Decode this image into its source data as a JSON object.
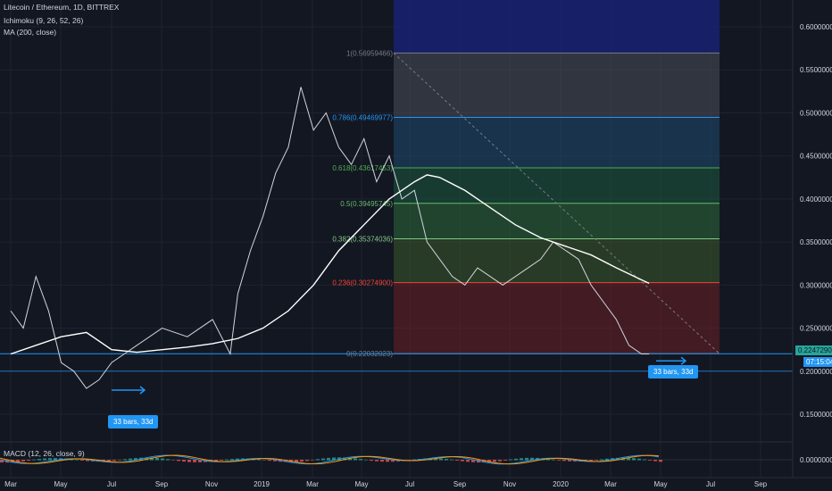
{
  "header": {
    "symbol_line": "Litecoin / Ethereum, 1D, BITTREX",
    "indicator_1": "Ichimoku (9, 26, 52, 26)",
    "indicator_2": "MA (200, close)",
    "macd_label": "MACD (12, 26, close, 9)"
  },
  "chart_data": {
    "type": "line",
    "title": "Litecoin / Ethereum, 1D, BITTREX",
    "x_tick_labels": [
      "Mar",
      "May",
      "Jul",
      "Sep",
      "Nov",
      "2019",
      "Mar",
      "May",
      "Jul",
      "Sep",
      "Nov",
      "2020",
      "Mar",
      "May",
      "Jul",
      "Sep"
    ],
    "y_tick_labels": [
      "0.60000000",
      "0.55000000",
      "0.50000000",
      "0.45000000",
      "0.40000000",
      "0.35000000",
      "0.30000000",
      "0.25000000",
      "0.20000000",
      "0.15000000"
    ],
    "ylim": [
      0.1,
      0.63
    ],
    "macd_tick_label": "0.00000000",
    "series": [
      {
        "name": "LTC/ETH close",
        "color": "#d1d4dc",
        "points": [
          [
            0,
            0.27
          ],
          [
            0.5,
            0.25
          ],
          [
            1,
            0.31
          ],
          [
            1.5,
            0.27
          ],
          [
            2,
            0.21
          ],
          [
            2.5,
            0.2
          ],
          [
            3,
            0.18
          ],
          [
            3.5,
            0.19
          ],
          [
            4,
            0.21
          ],
          [
            5,
            0.23
          ],
          [
            6,
            0.25
          ],
          [
            7,
            0.24
          ],
          [
            8,
            0.26
          ],
          [
            8.7,
            0.22
          ],
          [
            9,
            0.29
          ],
          [
            9.5,
            0.34
          ],
          [
            10,
            0.38
          ],
          [
            10.5,
            0.43
          ],
          [
            11,
            0.46
          ],
          [
            11.5,
            0.53
          ],
          [
            12,
            0.48
          ],
          [
            12.5,
            0.5
          ],
          [
            13,
            0.46
          ],
          [
            13.5,
            0.44
          ],
          [
            14,
            0.47
          ],
          [
            14.5,
            0.42
          ],
          [
            15,
            0.45
          ],
          [
            15.5,
            0.4
          ],
          [
            16,
            0.41
          ],
          [
            16.5,
            0.35
          ],
          [
            17,
            0.33
          ],
          [
            17.5,
            0.31
          ],
          [
            18,
            0.3
          ],
          [
            18.5,
            0.32
          ],
          [
            19,
            0.31
          ],
          [
            19.5,
            0.3
          ],
          [
            20,
            0.31
          ],
          [
            20.5,
            0.32
          ],
          [
            21,
            0.33
          ],
          [
            21.5,
            0.35
          ],
          [
            22,
            0.34
          ],
          [
            22.5,
            0.33
          ],
          [
            23,
            0.3
          ],
          [
            23.5,
            0.28
          ],
          [
            24,
            0.26
          ],
          [
            24.5,
            0.23
          ],
          [
            25,
            0.22
          ],
          [
            25.3,
            0.22
          ]
        ]
      },
      {
        "name": "MA (200, close)",
        "color": "#ffffff",
        "points": [
          [
            0,
            0.22
          ],
          [
            1,
            0.23
          ],
          [
            2,
            0.24
          ],
          [
            3,
            0.245
          ],
          [
            4,
            0.225
          ],
          [
            5,
            0.222
          ],
          [
            6,
            0.225
          ],
          [
            7,
            0.228
          ],
          [
            8,
            0.232
          ],
          [
            9,
            0.238
          ],
          [
            10,
            0.25
          ],
          [
            11,
            0.27
          ],
          [
            12,
            0.3
          ],
          [
            13,
            0.34
          ],
          [
            14,
            0.37
          ],
          [
            15,
            0.4
          ],
          [
            16,
            0.42
          ],
          [
            16.5,
            0.428
          ],
          [
            17,
            0.425
          ],
          [
            18,
            0.41
          ],
          [
            19,
            0.39
          ],
          [
            20,
            0.37
          ],
          [
            21,
            0.355
          ],
          [
            22,
            0.345
          ],
          [
            23,
            0.335
          ],
          [
            24,
            0.32
          ],
          [
            25,
            0.306
          ],
          [
            25.3,
            0.302
          ]
        ]
      }
    ],
    "fibonacci": {
      "levels": [
        {
          "ratio": "1",
          "price": "0.56959466",
          "color": "#787b86"
        },
        {
          "ratio": "0.786",
          "price": "0.49469977",
          "color": "#2196f3"
        },
        {
          "ratio": "0.618",
          "price": "0.43617453",
          "color": "#4caf50"
        },
        {
          "ratio": "0.5",
          "price": "0.39495745",
          "color": "#66bb6a"
        },
        {
          "ratio": "0.382",
          "price": "0.35374036",
          "color": "#81c784"
        },
        {
          "ratio": "0.236",
          "price": "0.30274900",
          "color": "#f44336"
        },
        {
          "ratio": "0",
          "price": "0.22032023",
          "color": "#787b86"
        }
      ]
    },
    "current_price": "0.22472902",
    "countdown": "07:15:04",
    "range_badges": [
      "33 bars, 33d",
      "33 bars, 33d"
    ]
  }
}
